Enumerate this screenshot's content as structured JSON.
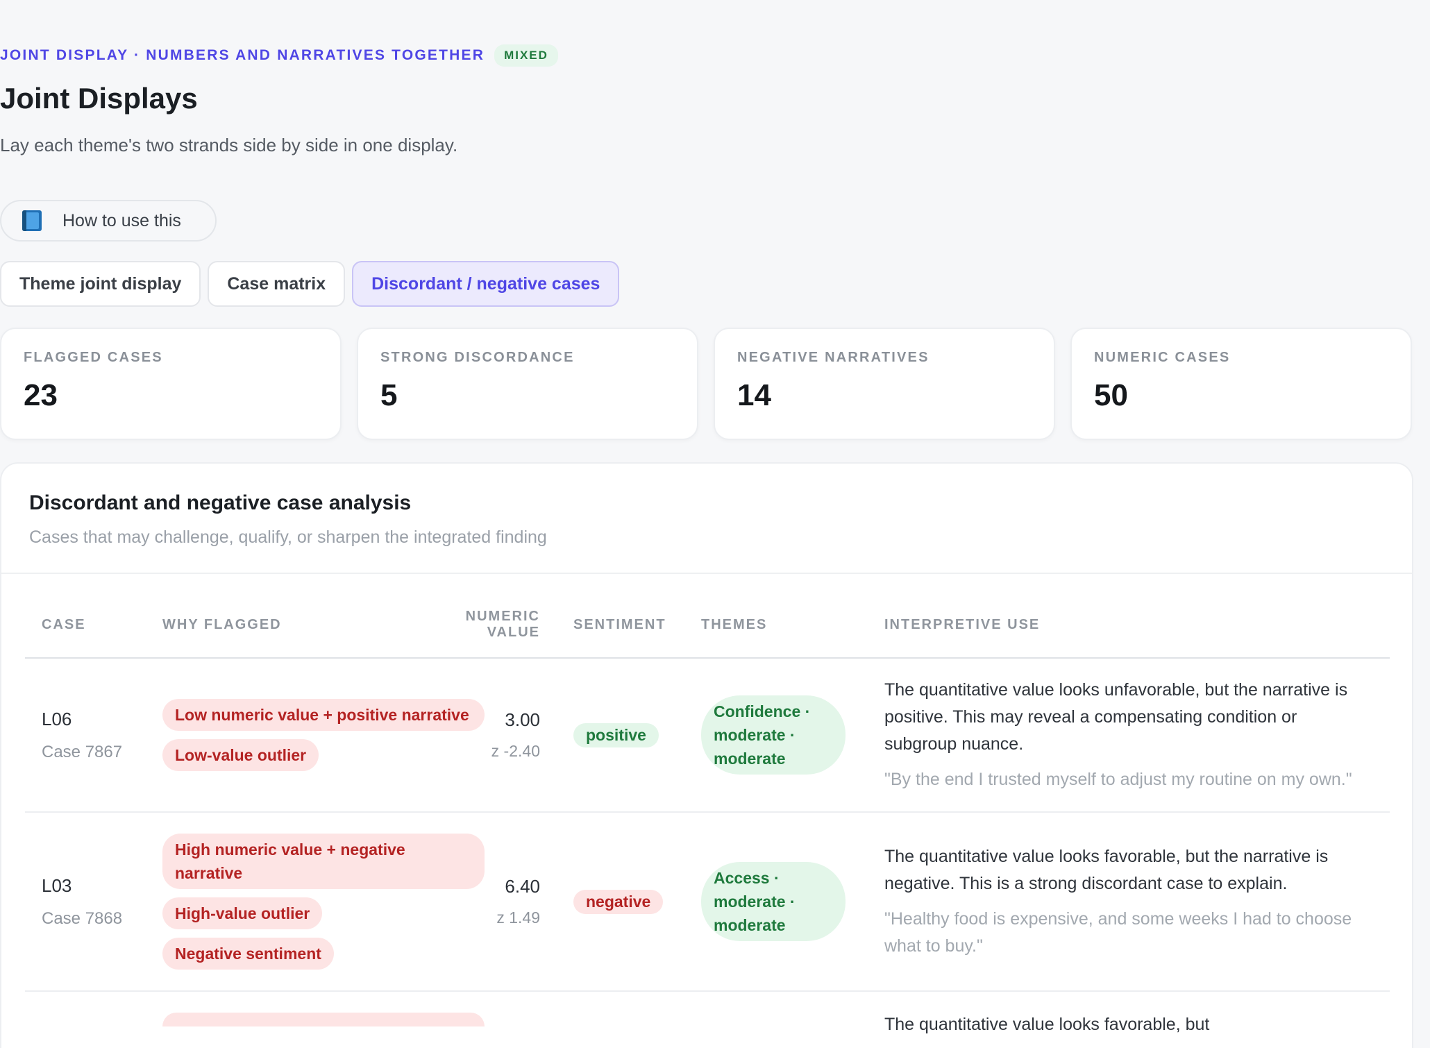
{
  "header": {
    "eyebrow": "JOINT DISPLAY · NUMBERS AND NARRATIVES TOGETHER",
    "badge": "MIXED",
    "title": "Joint Displays",
    "subtitle": "Lay each theme's two strands side by side in one display.",
    "help_icon": "book-icon",
    "help_label": "How to use this"
  },
  "tabs": [
    {
      "label": "Theme joint display",
      "active": false
    },
    {
      "label": "Case matrix",
      "active": false
    },
    {
      "label": "Discordant / negative cases",
      "active": true
    }
  ],
  "stats": [
    {
      "label": "FLAGGED CASES",
      "value": "23"
    },
    {
      "label": "STRONG DISCORDANCE",
      "value": "5"
    },
    {
      "label": "NEGATIVE NARRATIVES",
      "value": "14"
    },
    {
      "label": "NUMERIC CASES",
      "value": "50"
    }
  ],
  "panel": {
    "title": "Discordant and negative case analysis",
    "subtitle": "Cases that may challenge, qualify, or sharpen the integrated finding"
  },
  "table": {
    "columns": [
      "CASE",
      "WHY FLAGGED",
      "NUMERIC VALUE",
      "SENTIMENT",
      "THEMES",
      "INTERPRETIVE USE"
    ],
    "rows": [
      {
        "case": "L06",
        "case_sub": "Case 7867",
        "flags": [
          "Low numeric value + positive narrative",
          "Low-value outlier"
        ],
        "value": "3.00",
        "z": "z -2.40",
        "sentiment": "positive",
        "theme": "Confidence · moderate · moderate",
        "interpretation": "The quantitative value looks unfavorable, but the narrative is positive. This may reveal a compensating condition or subgroup nuance.",
        "quote": "\"By the end I trusted myself to adjust my routine on my own.\""
      },
      {
        "case": "L03",
        "case_sub": "Case 7868",
        "flags": [
          "High numeric value + negative narrative",
          "High-value outlier",
          "Negative sentiment"
        ],
        "value": "6.40",
        "z": "z 1.49",
        "sentiment": "negative",
        "theme": "Access · moderate · moderate",
        "interpretation": "The quantitative value looks favorable, but the narrative is negative. This is a strong discordant case to explain.",
        "quote": "\"Healthy food is expensive, and some weeks I had to choose what to buy.\""
      }
    ],
    "partial_row_text": "The quantitative value looks favorable, but"
  }
}
